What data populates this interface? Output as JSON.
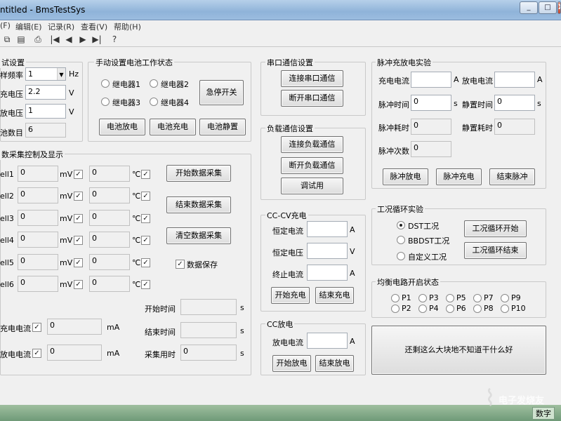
{
  "window": {
    "title": "ntitled - BmsTestSys",
    "min": "_",
    "max": "□",
    "close": "X"
  },
  "menu": [
    "(F)",
    "编辑(E)",
    "记录(R)",
    "查看(V)",
    "帮助(H)"
  ],
  "toolbar": [
    "⧉",
    "▤",
    "⎙",
    "|◀",
    "◀",
    "▶",
    "▶|",
    "?"
  ],
  "test_setup": {
    "title": "试设置",
    "rate_label": "样频率",
    "rate_value": "1",
    "rate_unit": "Hz",
    "charge_v_label": "充电压",
    "charge_v_value": "2.2",
    "charge_v_unit": "V",
    "discharge_v_label": "放电压",
    "discharge_v_value": "1",
    "discharge_v_unit": "V",
    "cells_label": "池数目",
    "cells_value": "6"
  },
  "manual": {
    "title": "手动设置电池工作状态",
    "relays": [
      "继电器1",
      "继电器2",
      "继电器3",
      "继电器4"
    ],
    "estop": "急停开关",
    "discharge": "电池放电",
    "charge": "电池充电",
    "rest": "电池静置"
  },
  "serial": {
    "title": "串口通信设置",
    "connect": "连接串口通信",
    "disconnect": "断开串口通信"
  },
  "load": {
    "title": "负载通信设置",
    "connect": "连接负载通信",
    "disconnect": "断开负载通信",
    "debug": "调试用"
  },
  "pulse": {
    "title": "脉冲充放电实验",
    "charge_i": "充电电流",
    "charge_i_unit": "A",
    "discharge_i": "放电电流",
    "discharge_i_unit": "A",
    "pulse_t": "脉冲时间",
    "pulse_t_val": "0",
    "pulse_t_unit": "s",
    "rest_t": "静置时间",
    "rest_t_val": "0",
    "rest_t_unit": "s",
    "pulse_used": "脉冲耗时",
    "pulse_used_val": "0",
    "rest_used": "静置耗时",
    "rest_used_val": "0",
    "count": "脉冲次数",
    "count_val": "0",
    "btn_discharge": "脉冲放电",
    "btn_charge": "脉冲充电",
    "btn_end": "结束脉冲"
  },
  "acq": {
    "title": "数采集控制及显示",
    "cells": [
      "ell1",
      "ell2",
      "ell3",
      "ell4",
      "ell5",
      "ell6"
    ],
    "cell_val": "0",
    "mv": "mV",
    "temp_val": "0",
    "degc": "℃",
    "start": "开始数据采集",
    "stop": "结束数据采集",
    "clear": "清空数据采集",
    "save": "数据保存",
    "chg_i": "充电电流",
    "dis_i": "放电电流",
    "cur_val": "0",
    "ma": "mA",
    "start_t": "开始时间",
    "end_t": "结束时间",
    "used_t": "采集用时",
    "used_val": "0",
    "s": "s"
  },
  "cccv": {
    "title": "CC-CV充电",
    "const_i": "恒定电流",
    "const_i_unit": "A",
    "const_v": "恒定电压",
    "const_v_unit": "V",
    "term_i": "终止电流",
    "term_i_unit": "A",
    "start": "开始充电",
    "end": "结束充电"
  },
  "cc": {
    "title": "CC放电",
    "dis_i": "放电电流",
    "dis_i_unit": "A",
    "start": "开始放电",
    "end": "结束放电"
  },
  "cycle": {
    "title": "工况循环实验",
    "opts": [
      "DST工况",
      "BBDST工况",
      "自定义工况"
    ],
    "start": "工况循环开始",
    "end": "工况循环结束"
  },
  "balance": {
    "title": "均衡电路开启状态",
    "ports": [
      "P1",
      "P3",
      "P5",
      "P7",
      "P9",
      "P2",
      "P4",
      "P6",
      "P8",
      "P10"
    ]
  },
  "spare_text": "还剩这么大块地不知道干什么好",
  "watermark": "电子发烧友",
  "taskbar_text": "数字"
}
